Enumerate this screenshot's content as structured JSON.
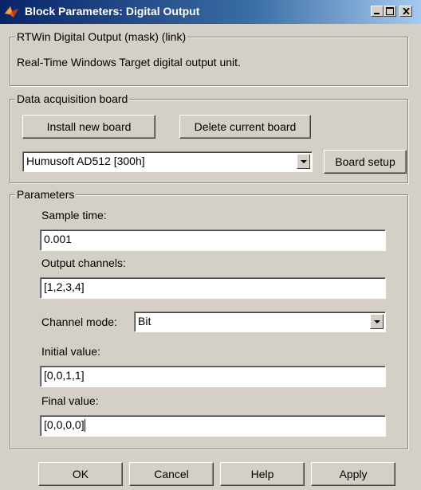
{
  "window": {
    "title": "Block Parameters: Digital Output"
  },
  "description_group": {
    "legend": "RTWin Digital Output (mask) (link)",
    "text": "Real-Time Windows Target digital output unit."
  },
  "board_group": {
    "legend": "Data acquisition board",
    "install_label": "Install new board",
    "delete_label": "Delete current board",
    "board_select_value": "Humusoft AD512 [300h]",
    "board_setup_label": "Board setup"
  },
  "params_group": {
    "legend": "Parameters",
    "sample_time_label": "Sample time:",
    "sample_time_value": "0.001",
    "output_channels_label": "Output channels:",
    "output_channels_value": "[1,2,3,4]",
    "channel_mode_label": "Channel mode:",
    "channel_mode_value": "Bit",
    "initial_value_label": "Initial value:",
    "initial_value_value": "[0,0,1,1]",
    "final_value_label": "Final value:",
    "final_value_value": "[0,0,0,0]"
  },
  "footer": {
    "ok_label": "OK",
    "cancel_label": "Cancel",
    "help_label": "Help",
    "apply_label": "Apply"
  },
  "colors": {
    "dialog_bg": "#d4d0c8",
    "titlebar_start": "#0a246a",
    "titlebar_end": "#a6caf0"
  }
}
